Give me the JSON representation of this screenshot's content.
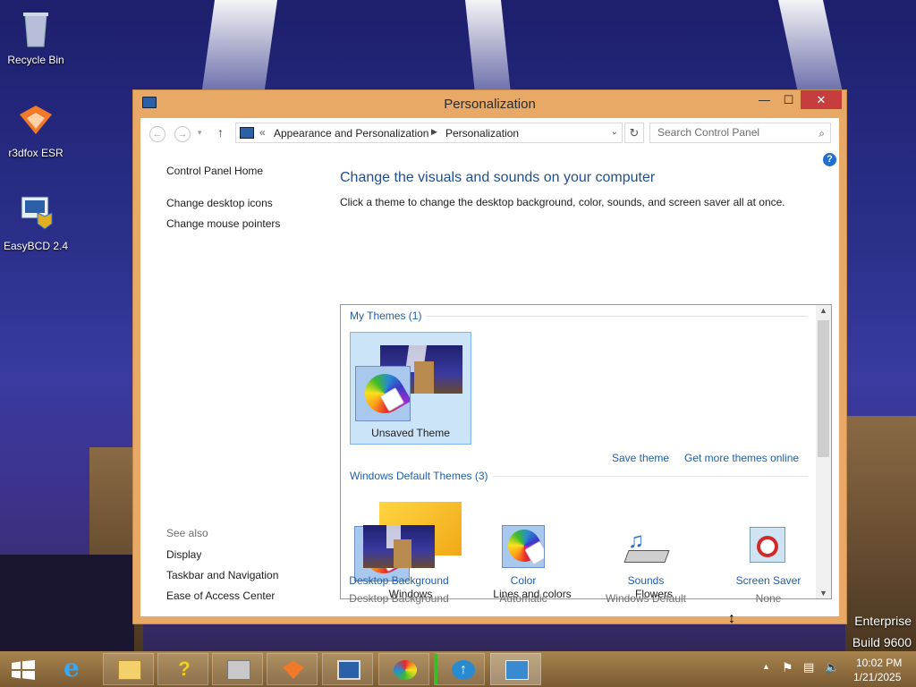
{
  "desktop": {
    "icons": [
      {
        "label": "Recycle Bin",
        "icon": "recycle-bin-icon"
      },
      {
        "label": "r3dfox ESR",
        "icon": "r3dfox-icon"
      },
      {
        "label": "EasyBCD 2.4",
        "icon": "easybcd-icon"
      }
    ],
    "watermark": {
      "edition": "Enterprise",
      "build": "Build 9600"
    }
  },
  "window": {
    "title": "Personalization",
    "controls": {
      "minimize": "—",
      "maximize": "☐",
      "close": "✕"
    }
  },
  "address_bar": {
    "breadcrumb_prefix": "«",
    "breadcrumb": [
      "Appearance and Personalization",
      "Personalization"
    ],
    "search_placeholder": "Search Control Panel"
  },
  "left_nav": {
    "home": "Control Panel Home",
    "links": [
      "Change desktop icons",
      "Change mouse pointers"
    ],
    "see_also_title": "See also",
    "see_also": [
      "Display",
      "Taskbar and Navigation",
      "Ease of Access Center"
    ]
  },
  "main": {
    "heading": "Change the visuals and sounds on your computer",
    "subtitle": "Click a theme to change the desktop background, color, sounds, and screen saver all at once.",
    "my_themes_header": "My Themes (1)",
    "my_themes": [
      {
        "name": "Unsaved Theme",
        "selected": true
      }
    ],
    "save_theme": "Save theme",
    "get_more": "Get more themes online",
    "default_header": "Windows Default Themes (3)",
    "default_themes": [
      {
        "name": "Windows"
      },
      {
        "name": "Lines and colors"
      },
      {
        "name": "Flowers"
      }
    ]
  },
  "bottom": [
    {
      "title": "Desktop Background",
      "value": "Desktop Background",
      "icon": "desktop-background-icon"
    },
    {
      "title": "Color",
      "value": "Automatic",
      "icon": "color-icon"
    },
    {
      "title": "Sounds",
      "value": "Windows Default",
      "icon": "sounds-icon"
    },
    {
      "title": "Screen Saver",
      "value": "None",
      "icon": "screen-saver-icon"
    }
  ],
  "taskbar": {
    "apps": [
      "start-icon",
      "internet-explorer-icon",
      "file-explorer-icon",
      "help-icon",
      "device-manager-icon",
      "r3dfox-icon",
      "remote-desktop-icon",
      "paint-icon",
      "update-icon",
      "personalization-icon"
    ],
    "time": "10:02 PM",
    "date": "1/21/2025"
  },
  "colors": {
    "accent": "#e8a866",
    "link": "#1f5fa8",
    "close": "#c73d3d"
  }
}
